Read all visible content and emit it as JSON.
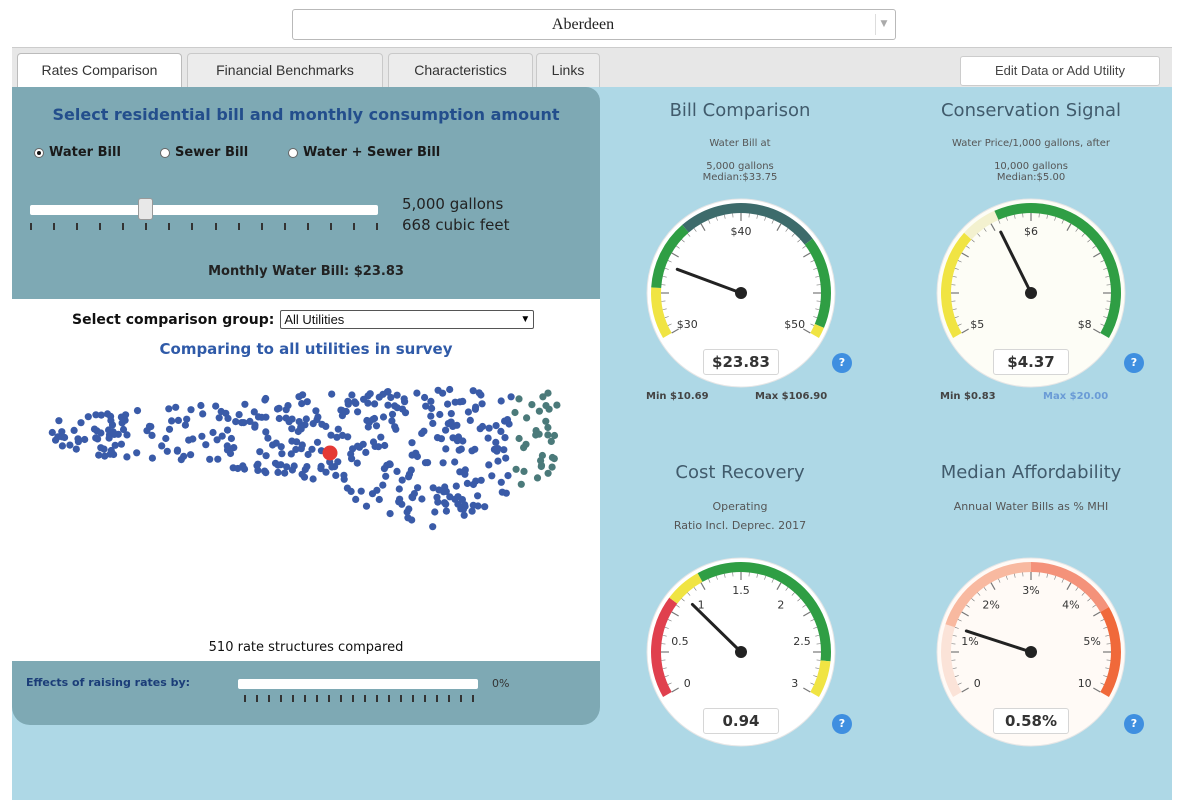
{
  "utility_select": {
    "value": "Aberdeen"
  },
  "tabs": [
    {
      "label": "Rates Comparison"
    },
    {
      "label": "Financial Benchmarks"
    },
    {
      "label": "Characteristics"
    },
    {
      "label": "Links"
    }
  ],
  "edit_button": "Edit Data or Add Utility",
  "rates": {
    "title": "Select residential bill and monthly consumption amount",
    "options": [
      "Water Bill",
      "Sewer Bill",
      "Water + Sewer Bill"
    ],
    "selected_option": "Water Bill",
    "gallons": "5,000 gallons",
    "cubic_feet": "668 cubic feet",
    "monthly_bill": "Monthly Water Bill: $23.83",
    "consumption_slider_level": 0.33
  },
  "comparison": {
    "label": "Select comparison group:",
    "selected": "All Utilities",
    "title": "Comparing to all utilities in survey",
    "count_text": "510 rate structures compared"
  },
  "effects": {
    "label": "Effects of raising rates by:",
    "value": "0%"
  },
  "gauges": {
    "bill": {
      "title": "Bill Comparison",
      "sub1": "Water Bill at",
      "sub2": "5,000 gallons",
      "sub3": "Median:$33.75",
      "value": "$23.83",
      "min": "Min $10.69",
      "max": "Max $106.90",
      "ticks": [
        "$30",
        "$40",
        "$50"
      ]
    },
    "conservation": {
      "title": "Conservation Signal",
      "sub1": "Water Price/1,000 gallons, after",
      "sub2": "10,000 gallons",
      "sub3": "Median:$5.00",
      "value": "$4.37",
      "min": "Min $0.83",
      "max": "Max $20.00",
      "ticks": [
        "$5",
        "$6",
        "$8"
      ]
    },
    "cost": {
      "title": "Cost Recovery",
      "sub1": "Operating",
      "sub2": "Ratio Incl. Deprec. 2017",
      "value": "0.94",
      "ticks": [
        "0",
        "0.5",
        "1",
        "1.5",
        "2",
        "2.5",
        "3"
      ]
    },
    "afford": {
      "title": "Median Affordability",
      "sub1": "Annual Water Bills as % MHI",
      "value": "0.58%",
      "ticks": [
        "0",
        "1%",
        "2%",
        "3%",
        "4%",
        "5%",
        "10"
      ]
    }
  },
  "help_label": "?",
  "colors": {
    "panel": "#aed8e6",
    "left_panel": "#7ea9b4",
    "dot": "#3a5ba8",
    "highlight_dot": "#e53935",
    "nearby_dot": "#4b7a7a",
    "gauge_green": "#2f9e44",
    "gauge_dark": "#3d6b6b",
    "gauge_yellow": "#f0e443",
    "gauge_red": "#e0404e",
    "gauge_orange": "#f0693a"
  }
}
